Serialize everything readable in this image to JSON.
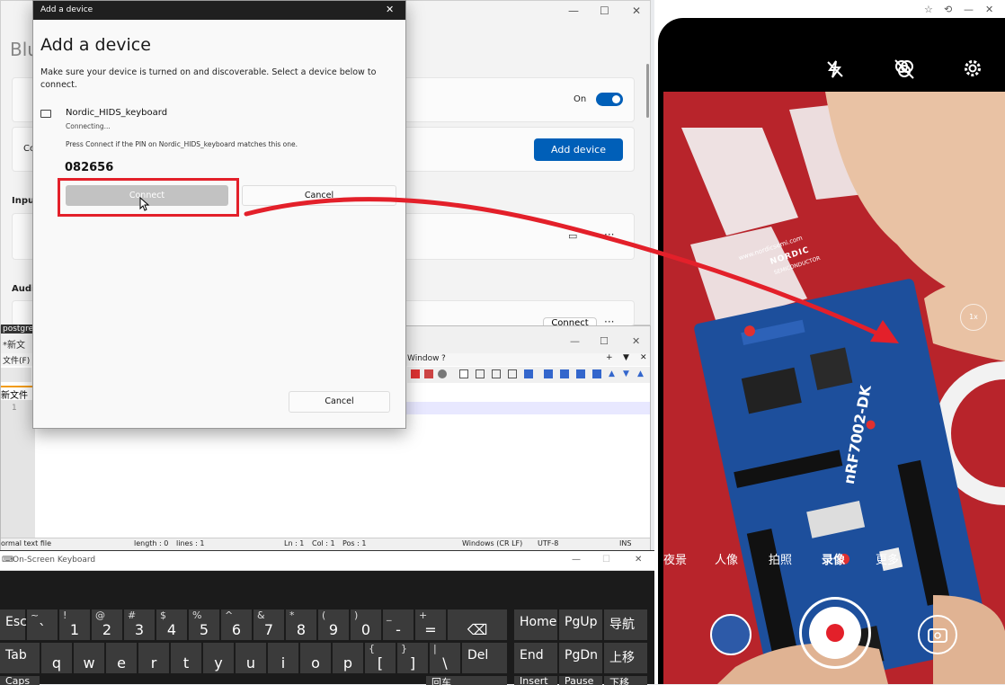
{
  "settings": {
    "title_partial": "Blu",
    "toggle_label": "On",
    "add_device_label": "Add device",
    "section_input_partial": "Inpu",
    "section_audio_partial": "Audi",
    "connect_label": "Connect",
    "left_partial": "Co",
    "more": "···"
  },
  "dialog": {
    "window_title": "Add a device",
    "heading": "Add a device",
    "instructions": "Make sure your device is turned on and discoverable. Select a device below to connect.",
    "device_name": "Nordic_HIDS_keyboard",
    "device_status": "Connecting...",
    "pin_prompt": "Press Connect if the PIN on Nordic_HIDS_keyboard matches this one.",
    "pin": "082656",
    "connect_label": "Connect",
    "cancel_label": "Cancel",
    "bottom_cancel_label": "Cancel"
  },
  "notepad": {
    "title_partial": "*新文",
    "menu_file": "文件(F)",
    "menu_window": "Window",
    "menu_help": "?",
    "tab_label": "新文件",
    "line_no": "1",
    "status": {
      "type": "ormal text file",
      "length": "length : 0",
      "lines": "lines : 1",
      "ln": "Ln : 1",
      "col": "Col : 1",
      "pos": "Pos : 1",
      "eol": "Windows (CR LF)",
      "enc": "UTF-8",
      "ins": "INS"
    },
    "partial_left": "postgres"
  },
  "osk": {
    "title": "On-Screen Keyboard",
    "row1": [
      {
        "main": "Esc",
        "shift": ""
      },
      {
        "main": "`",
        "shift": "~"
      },
      {
        "main": "1",
        "shift": "!"
      },
      {
        "main": "2",
        "shift": "@"
      },
      {
        "main": "3",
        "shift": "#"
      },
      {
        "main": "4",
        "shift": "$"
      },
      {
        "main": "5",
        "shift": "%"
      },
      {
        "main": "6",
        "shift": "^"
      },
      {
        "main": "7",
        "shift": "&"
      },
      {
        "main": "8",
        "shift": "*"
      },
      {
        "main": "9",
        "shift": "("
      },
      {
        "main": "0",
        "shift": ")"
      },
      {
        "main": "-",
        "shift": "_"
      },
      {
        "main": "=",
        "shift": "+"
      },
      {
        "main": "⌫",
        "shift": ""
      }
    ],
    "row2": [
      {
        "main": "Tab",
        "shift": ""
      },
      {
        "main": "q",
        "shift": ""
      },
      {
        "main": "w",
        "shift": ""
      },
      {
        "main": "e",
        "shift": ""
      },
      {
        "main": "r",
        "shift": ""
      },
      {
        "main": "t",
        "shift": ""
      },
      {
        "main": "y",
        "shift": ""
      },
      {
        "main": "u",
        "shift": ""
      },
      {
        "main": "i",
        "shift": ""
      },
      {
        "main": "o",
        "shift": ""
      },
      {
        "main": "p",
        "shift": ""
      },
      {
        "main": "[",
        "shift": "{"
      },
      {
        "main": "]",
        "shift": "}"
      },
      {
        "main": "\\",
        "shift": "|"
      },
      {
        "main": "Del",
        "shift": ""
      }
    ],
    "nav": {
      "home": "Home",
      "pgup": "PgUp",
      "cn_nav": "导航",
      "end": "End",
      "pgdn": "PgDn",
      "cn_up": "上移"
    },
    "row3_partial": [
      "Caps",
      "回车",
      "Insert",
      "Pause",
      "下移"
    ]
  },
  "phone": {
    "modes": [
      "夜景",
      "人像",
      "拍照",
      "录像",
      "更多"
    ],
    "active_mode": "录像",
    "zoom": "1x",
    "brand": "NORDIC",
    "brand_sub": "SEMICONDUCTOR",
    "board_label": "nRF7002-DK",
    "url": "www.nordicsemi.com"
  },
  "colors": {
    "accent": "#005fb8",
    "annotation": "#e3202a",
    "camera_bg": "#b8242b",
    "board": "#1d4f9c"
  }
}
